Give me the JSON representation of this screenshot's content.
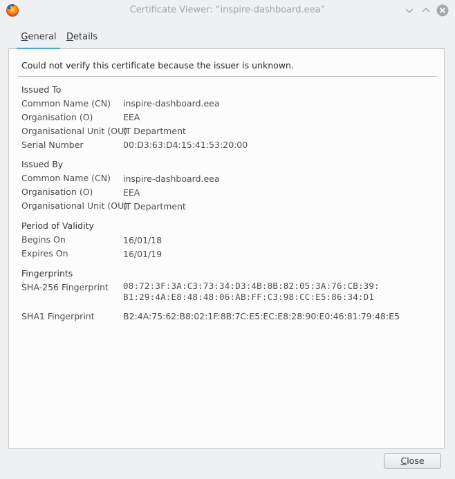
{
  "window": {
    "title": "Certificate Viewer: “inspire-dashboard.eea”"
  },
  "tabs": [
    {
      "label": "General",
      "mnemonic": "G",
      "rest": "eneral",
      "active": true
    },
    {
      "label": "Details",
      "mnemonic": "D",
      "rest": "etails",
      "active": false
    }
  ],
  "warning": "Could not verify this certificate because the issuer is unknown.",
  "issued_to": {
    "heading": "Issued To",
    "rows": [
      {
        "label": "Common Name (CN)",
        "value": "inspire-dashboard.eea"
      },
      {
        "label": "Organisation (O)",
        "value": "EEA"
      },
      {
        "label": "Organisational Unit (OU)",
        "value": "IT Department"
      },
      {
        "label": "Serial Number",
        "value": "00:D3:63:D4:15:41:53:20:00"
      }
    ]
  },
  "issued_by": {
    "heading": "Issued By",
    "rows": [
      {
        "label": "Common Name (CN)",
        "value": "inspire-dashboard.eea"
      },
      {
        "label": "Organisation (O)",
        "value": "EEA"
      },
      {
        "label": "Organisational Unit (OU)",
        "value": "IT Department"
      }
    ]
  },
  "validity": {
    "heading": "Period of Validity",
    "rows": [
      {
        "label": "Begins On",
        "value": "16/01/18"
      },
      {
        "label": "Expires On",
        "value": "16/01/19"
      }
    ]
  },
  "fingerprints": {
    "heading": "Fingerprints",
    "sha256": {
      "label": "SHA-256 Fingerprint",
      "line1": "08:72:3F:3A:C3:73:34:D3:4B:8B:82:05:3A:76:CB:39:",
      "line2": "B1:29:4A:E8:48:48:06:AB:FF:C3:98:CC:E5:86:34:D1"
    },
    "sha1": {
      "label": "SHA1 Fingerprint",
      "value": "B2:4A:75:62:B8:02:1F:8B:7C:E5:EC:E8:28:90:E0:46:81:79:48:E5"
    }
  },
  "buttons": {
    "close": "Close",
    "close_mnemonic": "C",
    "close_rest": "lose"
  }
}
